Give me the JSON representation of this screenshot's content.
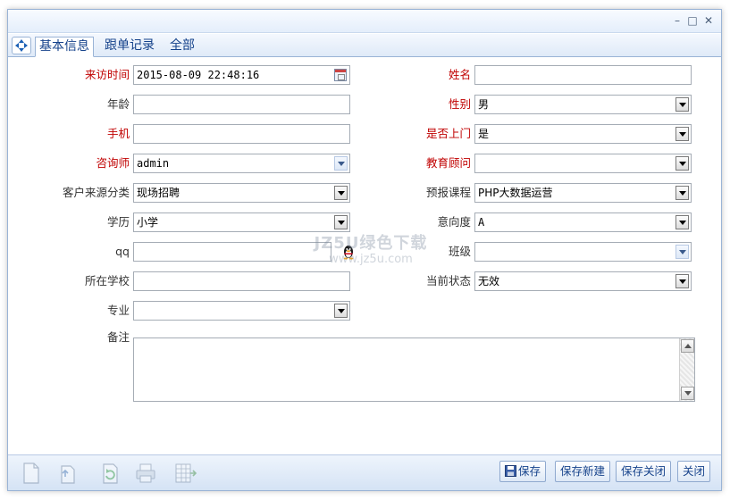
{
  "window": {
    "minimize_symbol": "–",
    "maximize_symbol": "□",
    "close_symbol": "✕"
  },
  "tabs": [
    {
      "label": "基本信息",
      "active": true
    },
    {
      "label": "跟单记录",
      "active": false
    },
    {
      "label": "全部",
      "active": false
    }
  ],
  "form": {
    "visit_time": {
      "label": "来访时间",
      "value": "2015-08-09 22:48:16",
      "required": true
    },
    "name": {
      "label": "姓名",
      "value": "",
      "required": true
    },
    "age": {
      "label": "年龄",
      "value": ""
    },
    "gender": {
      "label": "性别",
      "value": "男",
      "required": true
    },
    "phone": {
      "label": "手机",
      "value": "",
      "required": true
    },
    "visited": {
      "label": "是否上门",
      "value": "是",
      "required": true
    },
    "consultant": {
      "label": "咨询师",
      "value": "admin",
      "required": true
    },
    "edu_advisor": {
      "label": "教育顾问",
      "value": "",
      "required": true
    },
    "source_category": {
      "label": "客户来源分类",
      "value": "现场招聘"
    },
    "course": {
      "label": "预报课程",
      "value": "PHP大数据运营"
    },
    "education": {
      "label": "学历",
      "value": "小学"
    },
    "intent": {
      "label": "意向度",
      "value": "A"
    },
    "qq": {
      "label": "qq",
      "value": ""
    },
    "class": {
      "label": "班级",
      "value": ""
    },
    "school": {
      "label": "所在学校",
      "value": ""
    },
    "status": {
      "label": "当前状态",
      "value": "无效"
    },
    "major": {
      "label": "专业",
      "value": ""
    },
    "remark": {
      "label": "备注",
      "value": ""
    }
  },
  "watermark": {
    "line1": "JZ5U绿色下载",
    "line2": "www.jz5u.com"
  },
  "actions": {
    "save": "保存",
    "save_new": "保存新建",
    "save_close": "保存关闭",
    "close": "关闭"
  },
  "colors": {
    "required_label": "#c00000",
    "tab_text": "#15428b",
    "border": "#9ab4d6"
  }
}
